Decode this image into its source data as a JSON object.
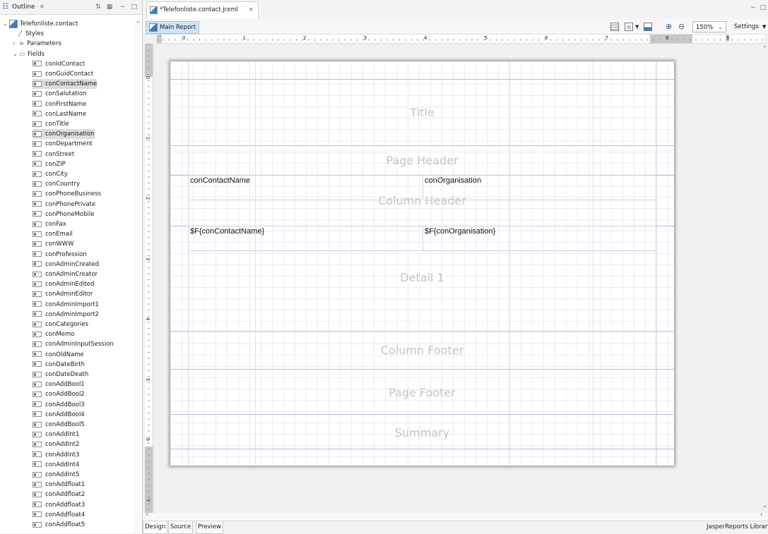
{
  "outline": {
    "tab_title": "Outline",
    "root": "Telefonliste.contact",
    "styles": "Styles",
    "parameters": "Parameters",
    "fields_label": "Fields",
    "fields": [
      "conIdContact",
      "conGuidContact",
      "conContactName",
      "conSalutation",
      "conFirstName",
      "conLastName",
      "conTitle",
      "conOrganisation",
      "conDepartment",
      "conStreet",
      "conZIP",
      "conCity",
      "conCountry",
      "conPhoneBusiness",
      "conPhonePrivate",
      "conPhoneMobile",
      "conFax",
      "conEmail",
      "conWWW",
      "conProfession",
      "conAdminCreated",
      "conAdminCreator",
      "conAdminEdited",
      "conAdminEditor",
      "conAdminImport1",
      "conAdminImport2",
      "conCategories",
      "conMemo",
      "conAdminInputSession",
      "conOldName",
      "conDateBirth",
      "conDateDeath",
      "conAddBool1",
      "conAddBool2",
      "conAddBool3",
      "conAddBool4",
      "conAddBool5",
      "conAddInt1",
      "conAddInt2",
      "conAddInt3",
      "conAddInt4",
      "conAddInt5",
      "conAddfloat1",
      "conAddfloat2",
      "conAddfloat3",
      "conAddfloat4",
      "conAddfloat5"
    ],
    "selected": [
      "conContactName",
      "conOrganisation"
    ]
  },
  "editor": {
    "tab_title": "*Telefonliste.contact.jrxml",
    "main_report": "Main Report",
    "zoom": "150%",
    "settings": "Settings",
    "ruler_numbers": [
      "0",
      "1",
      "2",
      "3",
      "4",
      "5",
      "6",
      "7",
      "8",
      "9"
    ],
    "vruler_numbers": [
      "0",
      "1",
      "2",
      "3",
      "4",
      "5",
      "6",
      "7"
    ]
  },
  "report": {
    "bands": {
      "title": "Title",
      "page_header": "Page Header",
      "column_header": "Column Header",
      "detail": "Detail 1",
      "column_footer": "Column Footer",
      "page_footer": "Page Footer",
      "summary": "Summary"
    },
    "header_fields": {
      "contact": "conContactName",
      "organisation": "conOrganisation"
    },
    "detail_fields": {
      "contact": "$F{conContactName}",
      "organisation": "$F{conOrganisation}"
    }
  },
  "bottom_tabs": [
    "Design",
    "Source",
    "Preview"
  ],
  "footer_right": "JasperReports Library",
  "colors": {
    "band_line": "#b7b9e6",
    "selection": "#dcdcdc",
    "main_report_bg": "#cfe3f6"
  }
}
